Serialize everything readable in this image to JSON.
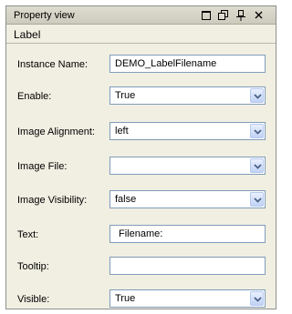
{
  "window": {
    "title": "Property view"
  },
  "header": {
    "label": "Label"
  },
  "properties": [
    {
      "label": "Instance Name:",
      "type": "text",
      "value": "DEMO_LabelFilename"
    },
    {
      "label": "Enable:",
      "type": "select",
      "value": "True"
    },
    {
      "label": "Image Alignment:",
      "type": "select",
      "value": "left"
    },
    {
      "label": "Image File:",
      "type": "select",
      "value": ""
    },
    {
      "label": "Image Visibility:",
      "type": "select",
      "value": "false"
    },
    {
      "label": "Text:",
      "type": "text",
      "value": "Filename:"
    },
    {
      "label": "Tooltip:",
      "type": "text",
      "value": ""
    },
    {
      "label": "Visible:",
      "type": "select",
      "value": "True"
    }
  ],
  "icons": {
    "maximize": "maximize-icon",
    "restore": "restore-icon",
    "pin": "pin-icon",
    "close": "close-icon",
    "dropdown": "chevron-down-icon"
  },
  "colors": {
    "panel_bg": "#f1efe2",
    "field_border": "#7f9db9",
    "dropdown_arrow": "#4d6185"
  }
}
